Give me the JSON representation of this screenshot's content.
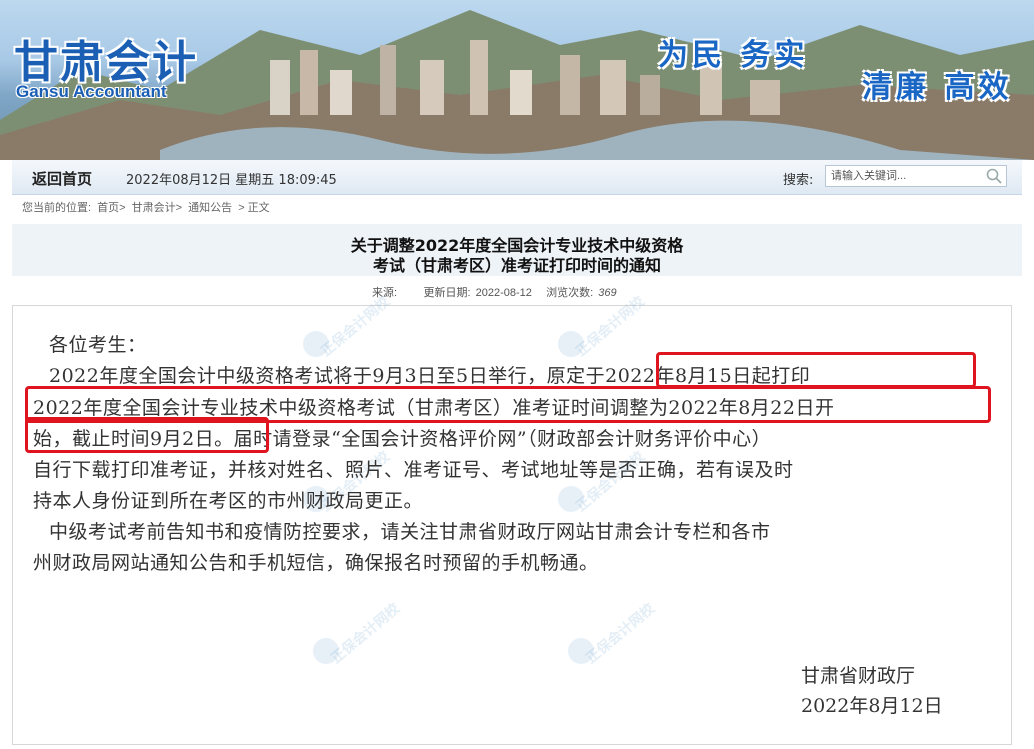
{
  "header": {
    "logo_cn": "甘肃会计",
    "logo_en": "Gansu Accountant",
    "slogan_1": "为民 务实",
    "slogan_2": "清廉 高效"
  },
  "nav": {
    "home_label": "返回首页",
    "datetime": "2022年08月12日   星期五   18:09:45",
    "search_label": "搜索:",
    "search_placeholder": "请输入关键词..."
  },
  "breadcrumb": {
    "prefix": "您当前的位置:",
    "items": [
      "首页>",
      "甘肃会计>",
      "通知公告",
      "> 正文"
    ]
  },
  "article": {
    "title_line1": "关于调整2022年度全国会计专业技术中级资格",
    "title_line2": "考试（甘肃考区）准考证打印时间的通知",
    "meta": {
      "source_label": "来源:",
      "updated_label": "更新日期:",
      "updated_value": "2022-08-12",
      "views_label": "浏览次数:",
      "views_value": "369"
    },
    "body_lines": [
      "各位考生：",
      "    2022年度全国会计中级资格考试将于9月3日至5日举行，原定于2022年8月15日起打印",
      "2022年度全国会计专业技术中级资格考试（甘肃考区）准考证时间调整为2022年8月22日开",
      "始，截止时间9月2日。届时请登录“全国会计资格评价网”（财政部会计财务评价中心）",
      "自行下载打印准考证，并核对姓名、照片、准考证号、考试地址等是否正确，若有误及时",
      "持本人身份证到所在考区的市州财政局更正。",
      "    中级考试考前告知书和疫情防控要求，请关注甘肃省财政厅网站甘肃会计专栏和各市",
      "州财政局网站通知公告和手机短信，确保报名时预留的手机畅通。"
    ],
    "signature_org": "甘肃省财政厅",
    "signature_date": "2022年8月12日"
  },
  "watermark_text": "正保会计网校",
  "colors": {
    "brand_blue": "#1b5fb5",
    "highlight_red": "#e0141e"
  }
}
